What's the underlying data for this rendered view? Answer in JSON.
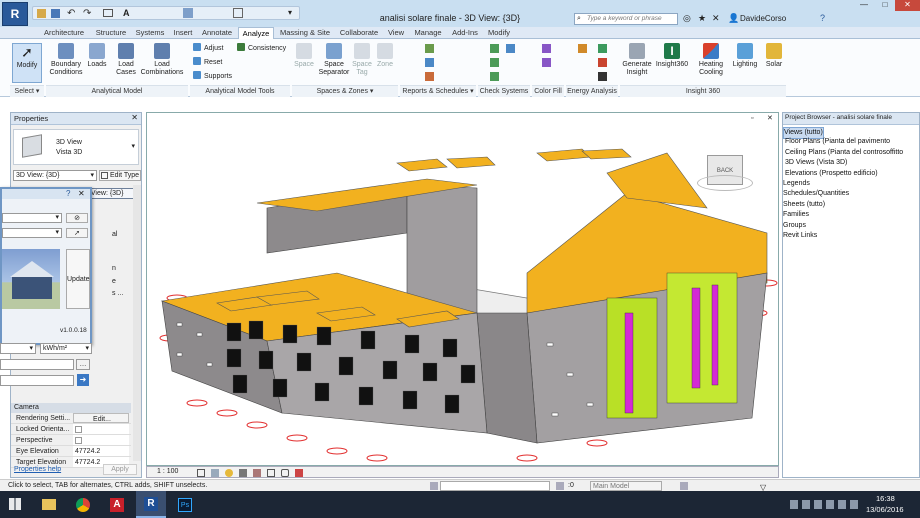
{
  "window": {
    "title": "analisi solare finale - 3D View: {3D}",
    "search_placeholder": "Type a keyword or phrase",
    "user": "DavideCorso"
  },
  "tabs": [
    "Architecture",
    "Structure",
    "Systems",
    "Insert",
    "Annotate",
    "Analyze",
    "Massing & Site",
    "Collaborate",
    "View",
    "Manage",
    "Add-Ins",
    "Modify"
  ],
  "active_tab": "Analyze",
  "ribbon": {
    "modify": "Modify",
    "boundary_conditions": "Boundary Conditions",
    "loads": "Loads",
    "load_cases": "Load Cases",
    "load_combinations": "Load Combinations",
    "adjust": "Adjust",
    "consistency": "Consistency",
    "reset": "Reset",
    "supports": "Supports",
    "space": "Space",
    "space_separator": "Space Separator",
    "space_tag": "Space Tag",
    "zone": "Zone",
    "generate_insight": "Generate Insight",
    "insight360": "Insight360",
    "heating_cooling": "Heating Cooling",
    "lighting": "Lighting",
    "solar": "Solar",
    "panels": [
      "Select ▾",
      "Analytical Model",
      "Analytical Model Tools",
      "Spaces & Zones ▾",
      "Reports & Schedules ▾",
      "Check Systems",
      "Color Fill",
      "Energy Analysis",
      "Insight 360"
    ]
  },
  "properties": {
    "title": "Properties",
    "type_line1": "3D View",
    "type_line2": "Vista 3D",
    "selector": "3D View: {3D}",
    "edit_type": "Edit Type",
    "tooltip": "3D View: {3D}",
    "section_camera": "Camera",
    "rows": [
      {
        "k": "Rendering Setti...",
        "v": "Edit..."
      },
      {
        "k": "Locked Orienta...",
        "v": ""
      },
      {
        "k": "Perspective",
        "v": ""
      },
      {
        "k": "Eye Elevation",
        "v": "47724.2"
      },
      {
        "k": "Target Elevation",
        "v": "47724.2"
      }
    ],
    "help": "Properties help",
    "apply": "Apply"
  },
  "float_panel": {
    "update": "Update",
    "version": "v1.0.0.18",
    "unit": "kWh/m²",
    "frag1": "al",
    "frag2": "n",
    "frag3": "e",
    "frag4": "s ..."
  },
  "project_browser": {
    "title": "Project Browser - analisi solare finale",
    "items": [
      {
        "label": "Views (tutto)",
        "level": 0,
        "selected": true
      },
      {
        "label": "Floor Plans (Pianta del pavimento",
        "level": 1
      },
      {
        "label": "Ceiling Plans (Pianta del controsoffitto",
        "level": 1
      },
      {
        "label": "3D Views (Vista 3D)",
        "level": 1
      },
      {
        "label": "Elevations (Prospetto edificio)",
        "level": 1
      },
      {
        "label": "Legends",
        "level": 0
      },
      {
        "label": "Schedules/Quantities",
        "level": 0
      },
      {
        "label": "Sheets (tutto)",
        "level": 0
      },
      {
        "label": "Families",
        "level": 0
      },
      {
        "label": "Groups",
        "level": 0
      },
      {
        "label": "Revit Links",
        "level": 0
      }
    ]
  },
  "viewport": {
    "scale": "1 : 100",
    "viewcube": "BACK"
  },
  "status": {
    "hint": "Click to select, TAB for alternates, CTRL adds, SHIFT unselects.",
    "model": "Main Model",
    "zero": ":0"
  },
  "taskbar": {
    "time": "16:38",
    "date": "13/06/2016"
  }
}
